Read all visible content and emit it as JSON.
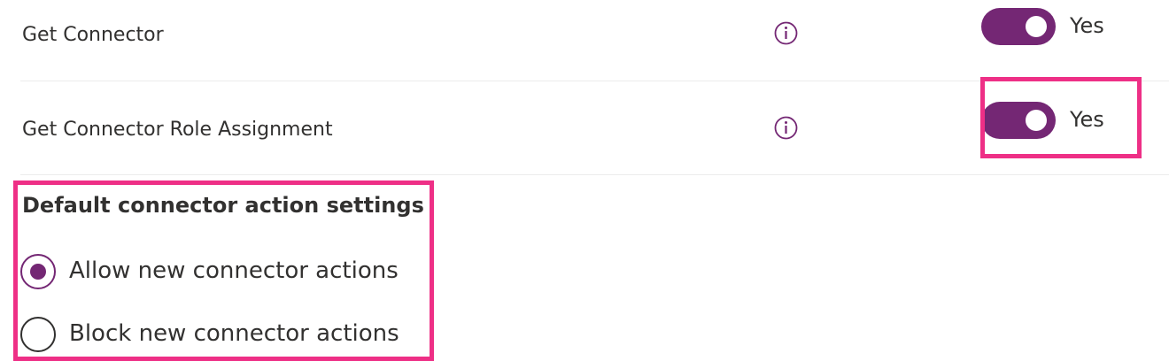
{
  "permissions": [
    {
      "label": "Get Connector",
      "toggle_text": "Yes",
      "enabled": true
    },
    {
      "label": "Get Connector Role Assignment",
      "toggle_text": "Yes",
      "enabled": true
    }
  ],
  "default_actions": {
    "title": "Default connector action settings",
    "options": [
      {
        "label": "Allow new connector actions",
        "selected": true
      },
      {
        "label": "Block new connector actions",
        "selected": false
      }
    ]
  },
  "colors": {
    "accent": "#742774",
    "highlight": "#ee2f86",
    "text": "#323130",
    "divider": "#ececec"
  },
  "icons": {
    "info": "info-icon"
  }
}
